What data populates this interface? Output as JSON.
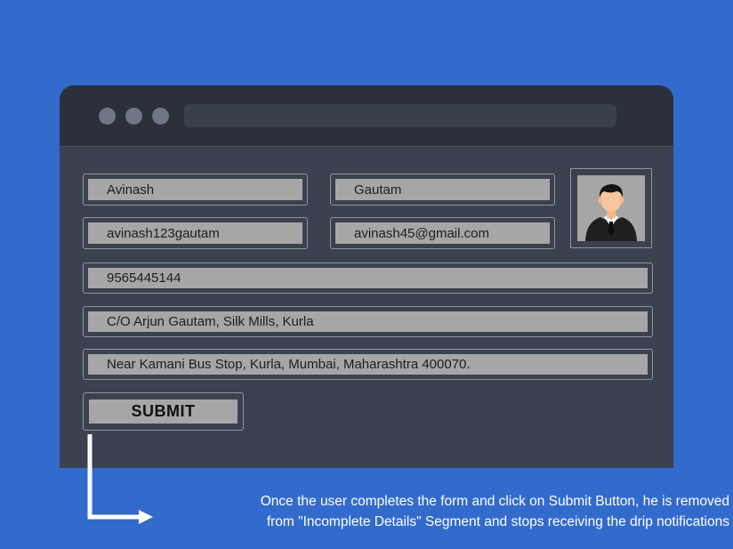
{
  "form": {
    "first_name": "Avinash",
    "last_name": "Gautam",
    "username": "avinash123gautam",
    "email": "avinash45@gmail.com",
    "phone": "9565445144",
    "address_line1": "C/O Arjun Gautam, Silk Mills, Kurla",
    "address_line2": "Near Kamani Bus Stop, Kurla, Mumbai, Maharashtra 400070.",
    "submit_label": "SUBMIT"
  },
  "avatar": {
    "icon": "user-avatar-icon"
  },
  "note": {
    "line1": "Once the user completes the form and click on Submit Button, he is removed",
    "line2": "from \"Incomplete Details\" Segment and stops receiving the drip notifications"
  },
  "colors": {
    "background": "#336bcc",
    "window": "#3c4150",
    "titlebar": "#2b303b",
    "field_fill": "#a6a6a6"
  }
}
